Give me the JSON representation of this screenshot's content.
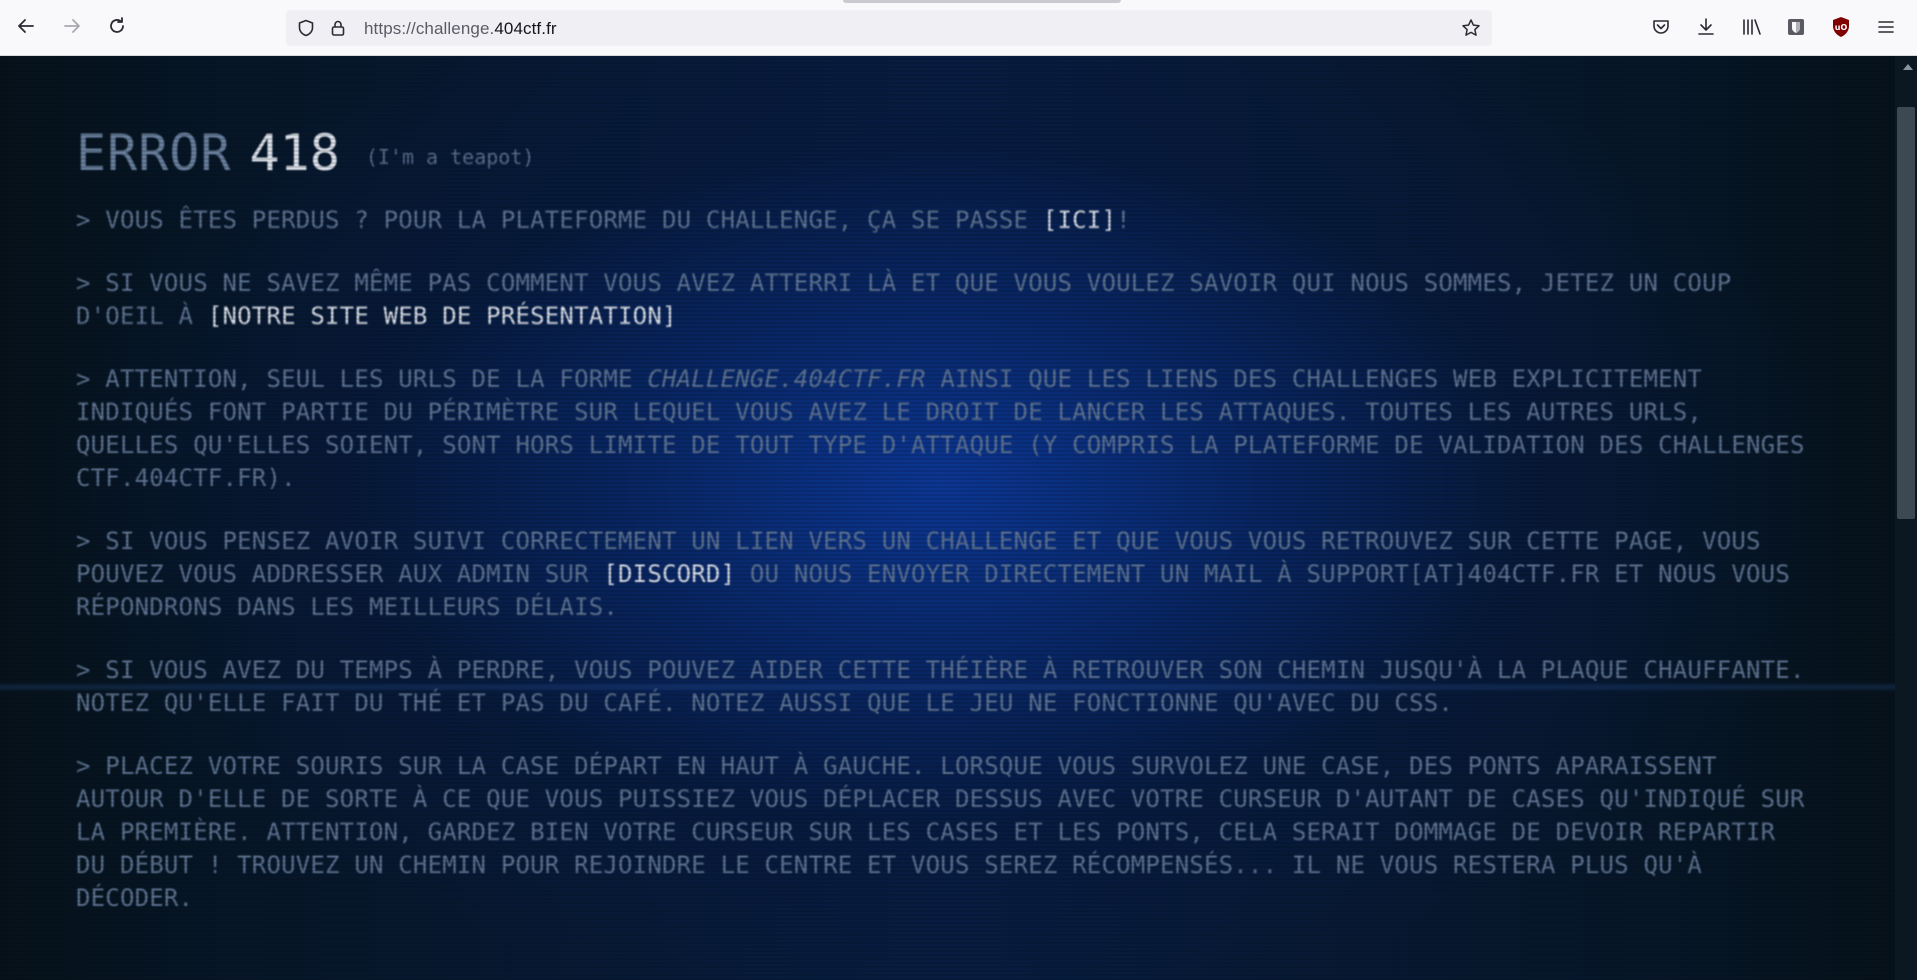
{
  "browser": {
    "url_prefix": "https://challenge.",
    "url_host": "404ctf.fr",
    "icons": {
      "back": "arrow-left-icon",
      "forward": "arrow-right-icon",
      "reload": "reload-icon",
      "tracking": "shield-icon",
      "lock": "lock-icon",
      "bookmark": "star-icon",
      "pocket": "pocket-icon",
      "downloads": "download-icon",
      "library": "library-icon",
      "bitwarden": "bitwarden-icon",
      "ublock": "ublock-icon",
      "menu": "hamburger-menu-icon"
    },
    "ublock_badge": "uO"
  },
  "page": {
    "title_word": "ERROR",
    "title_code": "418",
    "title_sub": "(I'm a teapot)",
    "p1": {
      "before": "> Vous êtes perdus ? Pour la plateforme du challenge, ça se passe ",
      "link": "[ici]",
      "after": "!"
    },
    "p2": {
      "before": "> Si vous ne savez même pas comment vous avez atterri là et que vous voulez savoir qui nous sommes, jetez un coup d'oeil à ",
      "link": "[notre site web de présentation]"
    },
    "p3": {
      "before": "> Attention, seul les urls de la forme ",
      "em": "challenge.404ctf.fr",
      "after": " ainsi que les liens des challenges web explicitement indiqués font partie du périmètre sur lequel vous avez le droit de lancer les attaques. Toutes les autres urls, quelles qu'elles soient, sont hors limite de tout type d'attaque (y compris la plateforme de validation des challenges ctf.404ctf.fr)."
    },
    "p4": {
      "before": "> Si vous pensez avoir suivi correctement un lien vers un challenge et que vous vous retrouvez sur cette page, vous pouvez vous addresser aux admin sur ",
      "link": "[Discord]",
      "after": " ou nous envoyer directement un mail à support[at]404ctf.fr et nous vous répondrons dans les meilleurs délais."
    },
    "p5": "> Si vous avez du temps à perdre, vous pouvez aider cette théière à retrouver son chemin jusqu'à la plaque chauffante. Notez qu'elle fait du thé et pas du café. Notez aussi que le jeu ne fonctionne qu'avec du CSS.",
    "p6": "> Placez votre souris sur la case départ en haut à gauche. Lorsque vous survolez une case, des ponts aparaissent autour d'elle de sorte à ce que vous puissiez vous déplacer dessus avec votre curseur d'autant de cases qu'indiqué sur la première. Attention, gardez bien votre curseur sur les cases et les ponts, cela serait dommage de devoir repartir du début ! Trouvez un chemin pour rejoindre le centre et vous serez récompensés... Il ne vous restera plus qu'à décoder."
  },
  "colors": {
    "chrome_bg": "#f9f9fb",
    "urlbar_bg": "#f0f0f4",
    "page_text": "#5e7391",
    "link_text": "#d8dde6",
    "background_glow": "#0c3796",
    "ublock_red": "#800000"
  }
}
